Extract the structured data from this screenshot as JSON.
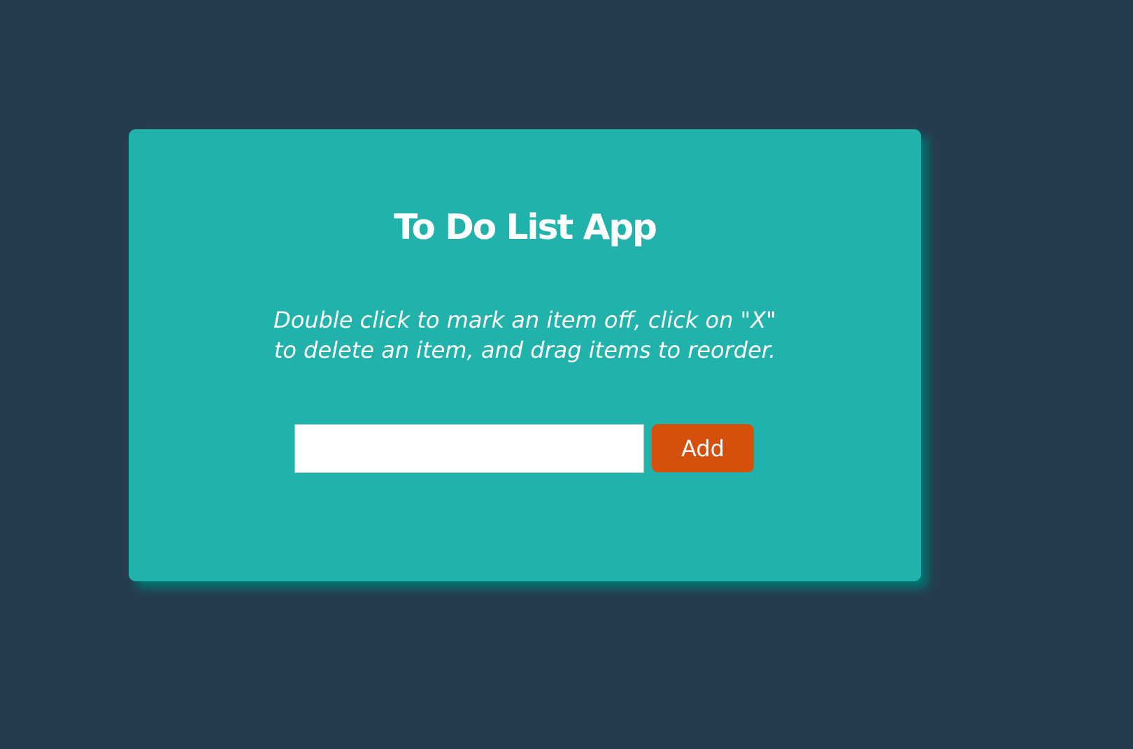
{
  "app": {
    "title": "To Do List App",
    "instructions": "Double click to mark an item off, click on \"X\" to delete an item, and drag items to reorder."
  },
  "new_item": {
    "value": "",
    "placeholder": "",
    "add_label": "Add"
  },
  "colors": {
    "page_background": "#253c4d",
    "card_background": "#21b2ab",
    "card_shadow": "#007876",
    "add_button": "#d64f0b",
    "text": "#ffffff"
  }
}
